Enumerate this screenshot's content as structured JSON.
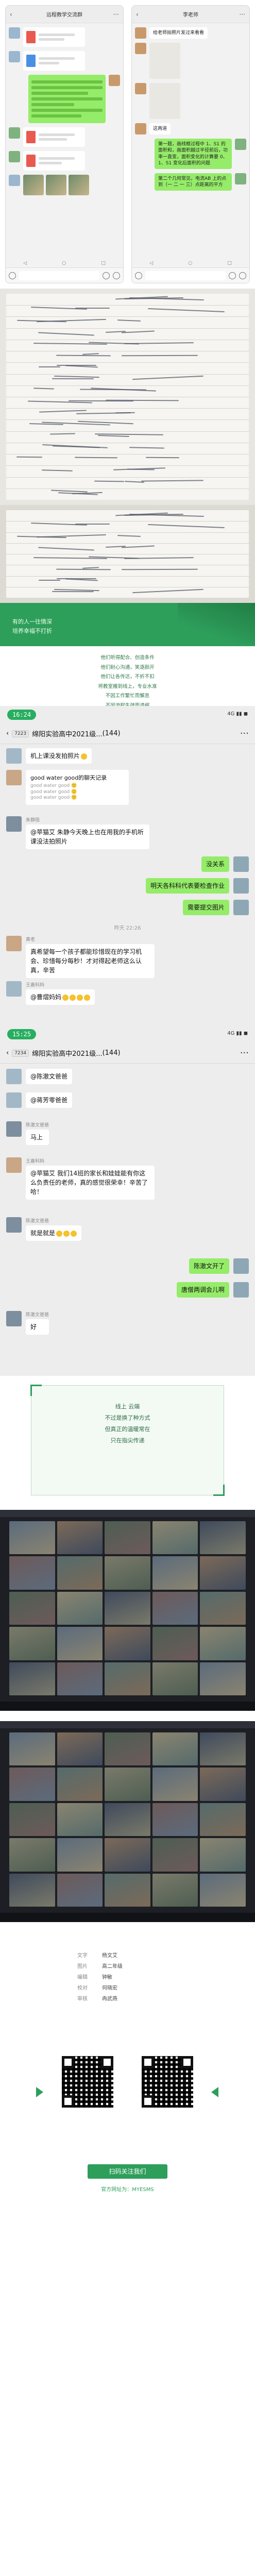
{
  "chat_left": {
    "title": "远程教学交流群",
    "msgs": [
      "课件已发送",
      "请同学们下载",
      "收到"
    ]
  },
  "chat_right": {
    "title": "李老师",
    "msg1": "给老师拍照片发过来看看",
    "msg2": "这两道",
    "q1": "第一题，画线框过程中 1、S1 的面积和，画面积越过半径前后，功率一直变，面积变化的计算要 0、1、S1 变化后面积的问题",
    "q2": "第二个几何常见，电流AB 上的点到（一 二 一 三）点距离的平方"
  },
  "banner": {
    "q1": "有的人一往情深",
    "q2": "培养幸福不打折",
    "lines": [
      "他们听得配合、创造条件",
      "他们耐心沟通，笑逐颜开",
      "他们让各传达，不折不扣",
      "将教室搬到线上，专业水准",
      "不因工作繁忙而懈怠",
      "不因流程生疏而退缩"
    ]
  },
  "chat_group1": {
    "time": "16:24",
    "status": "4G ▮▮ ◼",
    "group_id": "7223",
    "group_name": "绵阳实验高中2021级...",
    "member_count": "(144)",
    "m1": "机上课没发拍照片",
    "card_title": "good water good的聊天记录",
    "card_sub": "good water good 🙂\ngood water good 🙂\ngood water good 🙂",
    "sender2": "朱静阻",
    "m2": "@苹猫艾 朱静今天晚上也在用我的手机听课没法拍照片",
    "r1": "没关系",
    "r2": "明天各科科代表要检查作业",
    "r3": "需要提交图片",
    "midtime": "昨天 22:26",
    "sender3": "黄老",
    "m3": "真希望每一个孩子都能珍惜现在的学习机会、珍惜每分每秒！才对得起老师这么认真，辛苦",
    "sender4": "王嘉科妈",
    "m4": "@曹熠妈妈"
  },
  "chat_group2": {
    "time": "15:25",
    "status": "4G ▮▮ ◼",
    "group_id": "7234",
    "group_name": "绵阳实验高中2021级...",
    "member_count": "(144)",
    "m1": "@陈澈文爸爸",
    "m2": "@蒋芳零爸爸",
    "sender3": "陈澈文爸爸",
    "m3": "马上",
    "sender4": "王嘉科妈",
    "m4": "@苹猫艾 我们14班的家长和娃娃能有你这么负责任的老师，真的感觉很荣幸！辛苦了哈！",
    "sender5": "陈澈文爸爸",
    "m5": "就是就是",
    "r1": "陈澈文开了",
    "r2": "唐僧两调会儿啊",
    "sender6": "陈澈文爸爸",
    "m6": "好"
  },
  "quote2": {
    "lines": [
      "线上 云端",
      "不过是换了种方式",
      "但真正的温暖常在",
      "只在指尖传递"
    ]
  },
  "credits": {
    "rows": [
      {
        "k": "文字",
        "v": "杨文艾"
      },
      {
        "k": "图片",
        "v": "高二年级"
      },
      {
        "k": "编辑",
        "v": "钟敏"
      },
      {
        "k": "校对",
        "v": "何晓宏"
      },
      {
        "k": "审核",
        "v": "冉武燕"
      }
    ],
    "follow": "扫码关注我们",
    "site": "官方网址为：MYESMS",
    "qr_labels": [
      "",
      ""
    ]
  }
}
